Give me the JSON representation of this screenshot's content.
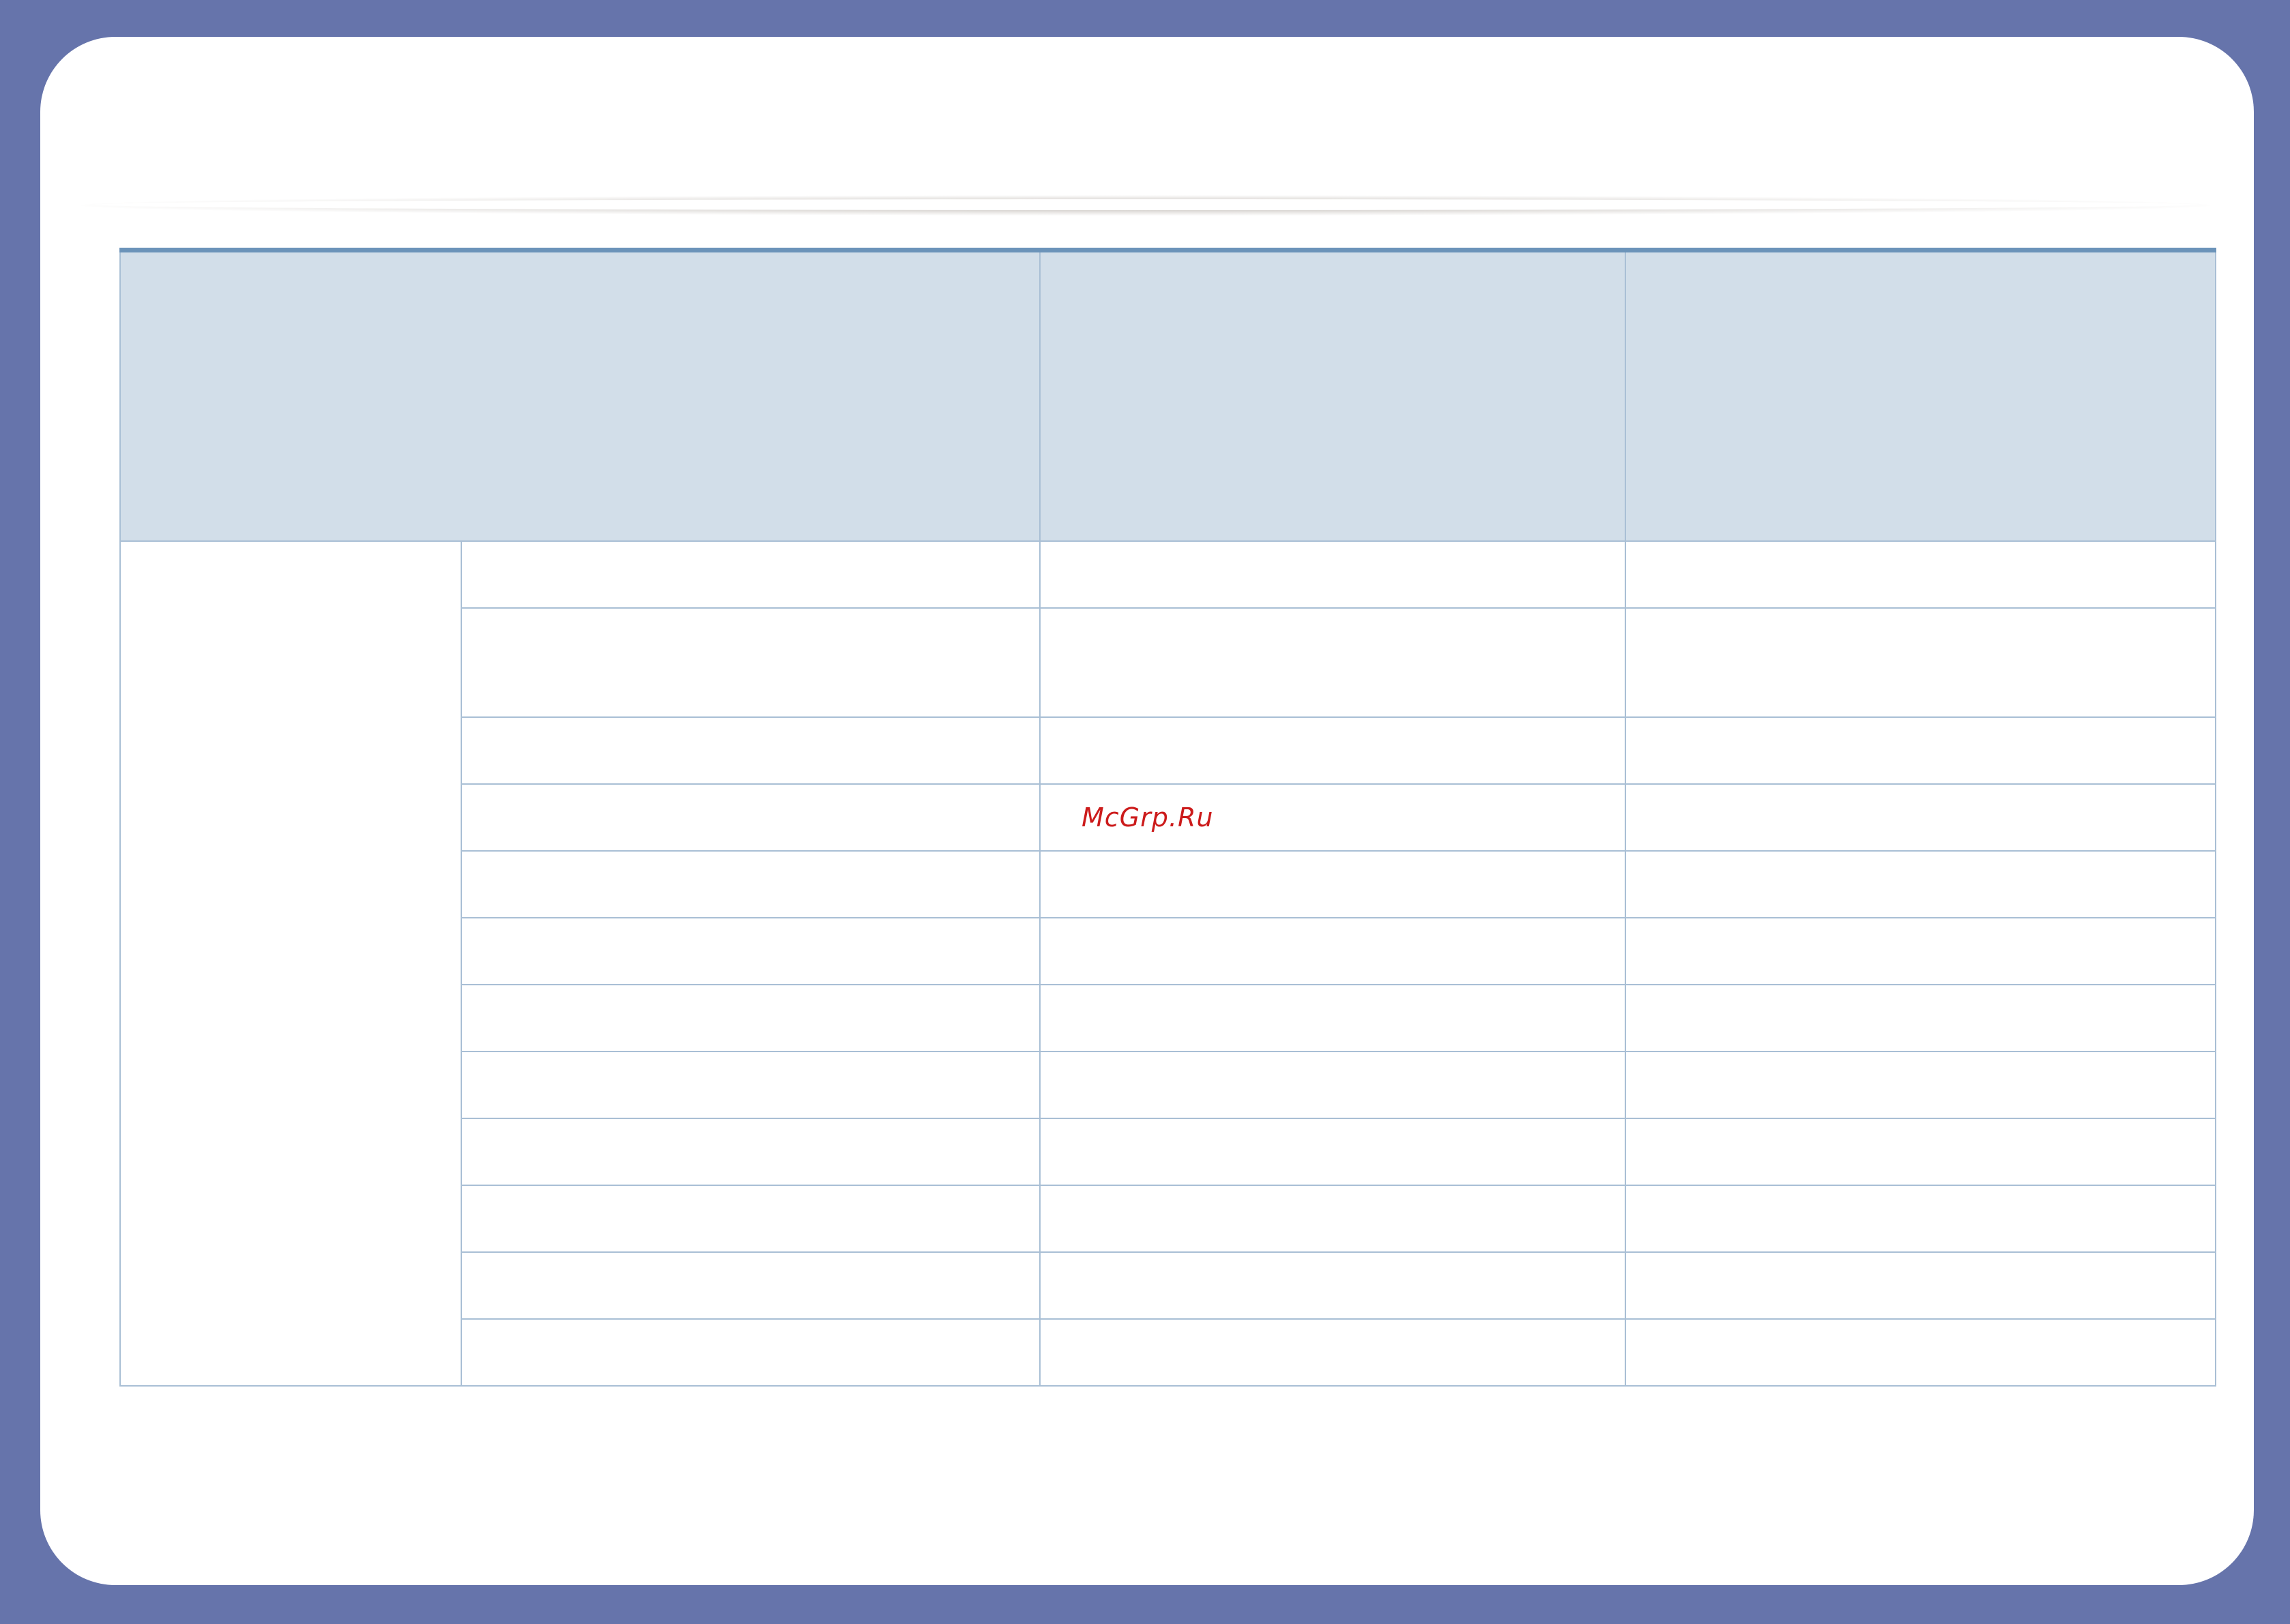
{
  "watermark": "McGrp.Ru",
  "table": {
    "header": [
      "",
      "",
      ""
    ],
    "group_label": "",
    "rows": [
      [
        "",
        "",
        ""
      ],
      [
        "",
        "",
        ""
      ],
      [
        "",
        "",
        ""
      ],
      [
        "",
        "",
        ""
      ],
      [
        "",
        "",
        ""
      ],
      [
        "",
        "",
        ""
      ],
      [
        "",
        "",
        ""
      ],
      [
        "",
        "",
        ""
      ],
      [
        "",
        "",
        ""
      ],
      [
        "",
        "",
        ""
      ],
      [
        "",
        "",
        ""
      ],
      [
        "",
        "",
        ""
      ]
    ]
  }
}
